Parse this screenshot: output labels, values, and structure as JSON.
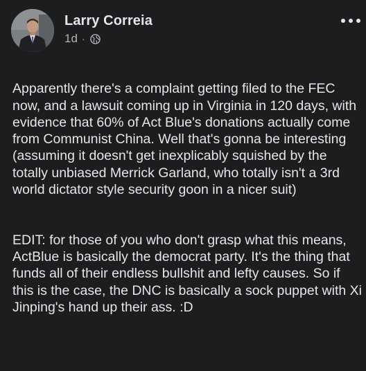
{
  "post": {
    "author": "Larry Correia",
    "time": "1d",
    "separator": "·",
    "visibility_icon": "globe-icon",
    "more_icon": "more-options-icon",
    "paragraph_1": "Apparently there's a complaint getting filed to the FEC now, and a lawsuit coming up in Virginia in 120 days, with evidence that 60% of Act Blue's donations actually come from Communist China. Well that's gonna be interesting (assuming it doesn't get inexplicably squished by the totally unbiased Merrick Garland, who totally isn't a 3rd world dictator style security goon in a nicer suit)",
    "paragraph_2": "EDIT: for those of you who don't grasp what this means, ActBlue is basically the democrat party. It's the thing that funds all of their endless bullshit and lefty causes. So if this is the case, the DNC is basically a sock puppet with Xi Jinping's hand up their ass. :D"
  },
  "colors": {
    "background": "#1c1d1e",
    "text": "#e4e6eb",
    "secondary_text": "#b0b3b8"
  }
}
